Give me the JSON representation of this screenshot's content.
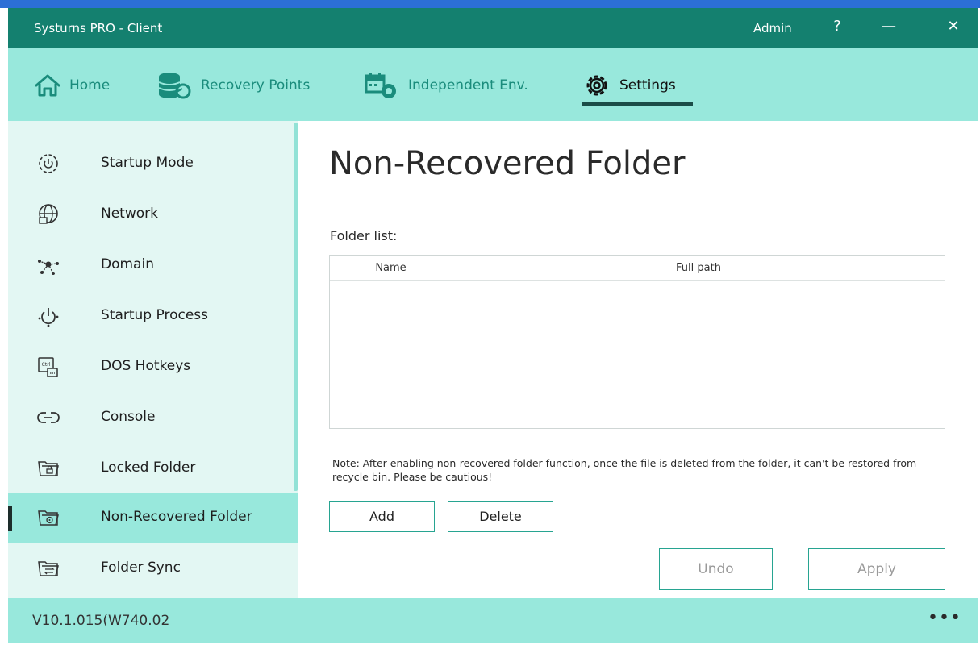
{
  "window": {
    "title": "Systurns PRO - Client",
    "user": "Admin",
    "help": "?",
    "minimize": "—",
    "close": "✕"
  },
  "nav": {
    "tabs": [
      {
        "label": "Home",
        "icon": "home-icon"
      },
      {
        "label": "Recovery Points",
        "icon": "database-restore-icon"
      },
      {
        "label": "Independent Env.",
        "icon": "calendar-env-icon"
      },
      {
        "label": "Settings",
        "icon": "gear-icon",
        "active": true
      }
    ]
  },
  "sidebar": {
    "items": [
      {
        "label": "Startup Mode",
        "icon": "startup-gear-icon"
      },
      {
        "label": "Network",
        "icon": "globe-icon"
      },
      {
        "label": "Domain",
        "icon": "domain-network-icon"
      },
      {
        "label": "Startup Process",
        "icon": "power-icon"
      },
      {
        "label": "DOS Hotkeys",
        "icon": "keyboard-ctrl-icon"
      },
      {
        "label": "Console",
        "icon": "console-link-icon"
      },
      {
        "label": "Locked Folder",
        "icon": "lock-folder-icon"
      },
      {
        "label": "Non-Recovered Folder",
        "icon": "non-recovered-folder-icon",
        "active": true
      },
      {
        "label": "Folder Sync",
        "icon": "folder-sync-icon"
      }
    ]
  },
  "main": {
    "title": "Non-Recovered Folder",
    "folder_list_label": "Folder list:",
    "table": {
      "columns": [
        "Name",
        "Full path"
      ],
      "rows": []
    },
    "note": "Note: After enabling non-recovered folder function, once the file is deleted from the folder, it can't be restored from recycle bin. Please be cautious!",
    "buttons": {
      "add": "Add",
      "delete": "Delete",
      "undo": "Undo",
      "apply": "Apply"
    }
  },
  "status": {
    "version": "V10.1.015(W740.02",
    "more": "•••"
  },
  "colors": {
    "titlebar": "#14806f",
    "nav": "#98e8dc",
    "sidebar": "#e3f7f3",
    "accent": "#27a491",
    "taskbar": "#2c6fd6"
  }
}
